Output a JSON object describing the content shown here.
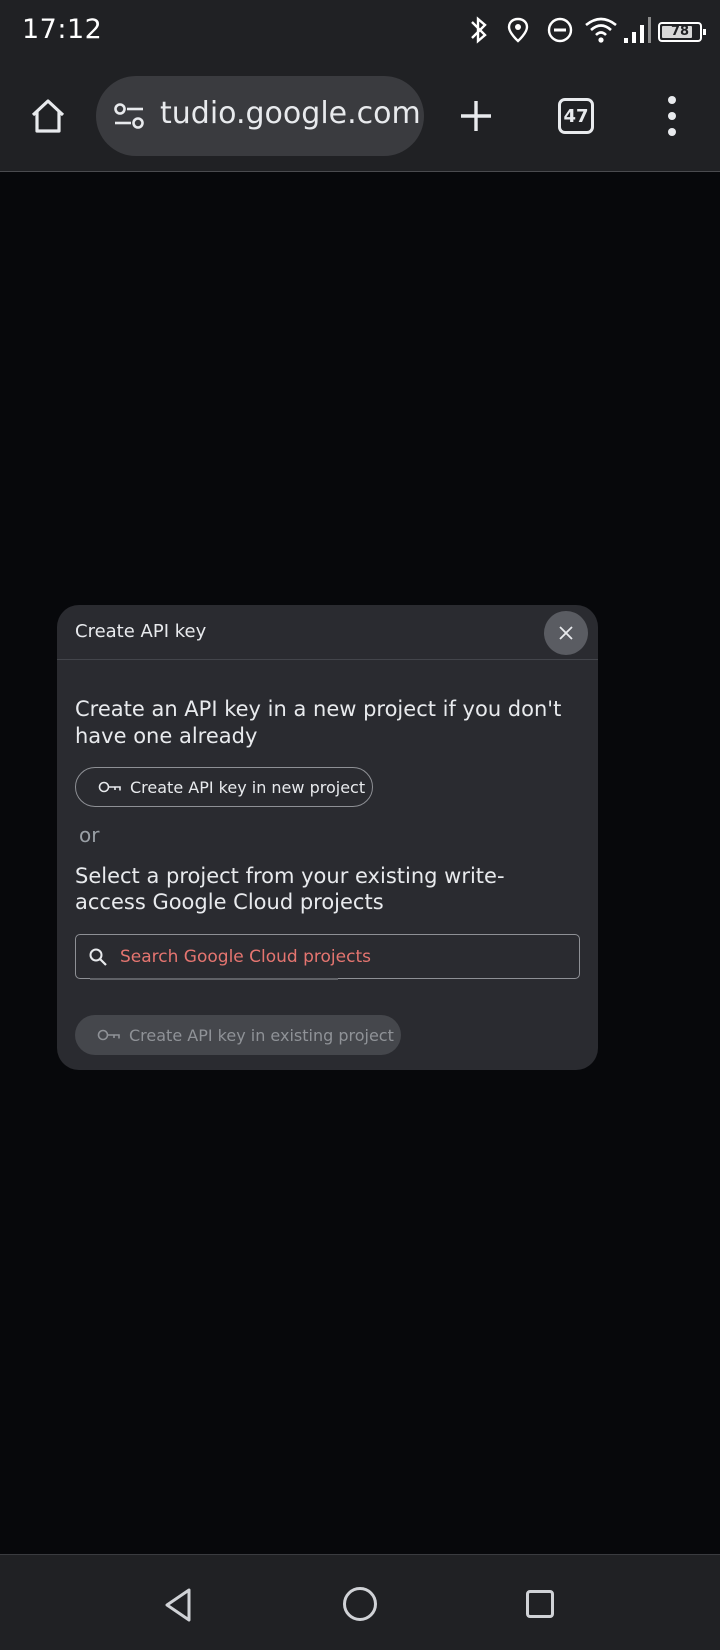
{
  "status_bar": {
    "time": "17:12",
    "battery_level": "78",
    "icons": [
      "bluetooth-icon",
      "location-icon",
      "do-not-disturb-icon",
      "wifi-icon",
      "signal-icon",
      "battery-icon"
    ]
  },
  "browser": {
    "url": "tudio.google.com",
    "tab_count": "47",
    "icons": [
      "home-icon",
      "site-settings-icon",
      "new-tab-icon",
      "tabs-icon",
      "more-menu-icon"
    ]
  },
  "dialog": {
    "title": "Create API key",
    "new_project_description": "Create an API key in a new project if you don't have one already",
    "new_project_button": "Create API key in new project",
    "or_label": "or",
    "existing_project_description": "Select a project from your existing write-access Google Cloud projects",
    "search": {
      "placeholder": "Search Google Cloud projects",
      "value": ""
    },
    "existing_project_button": "Create API key in existing project",
    "colors": {
      "placeholder": "#e57570",
      "surface": "#2a2b30"
    }
  },
  "nav_bar": {
    "icons": [
      "back-icon",
      "home-circle-icon",
      "recents-icon"
    ]
  }
}
